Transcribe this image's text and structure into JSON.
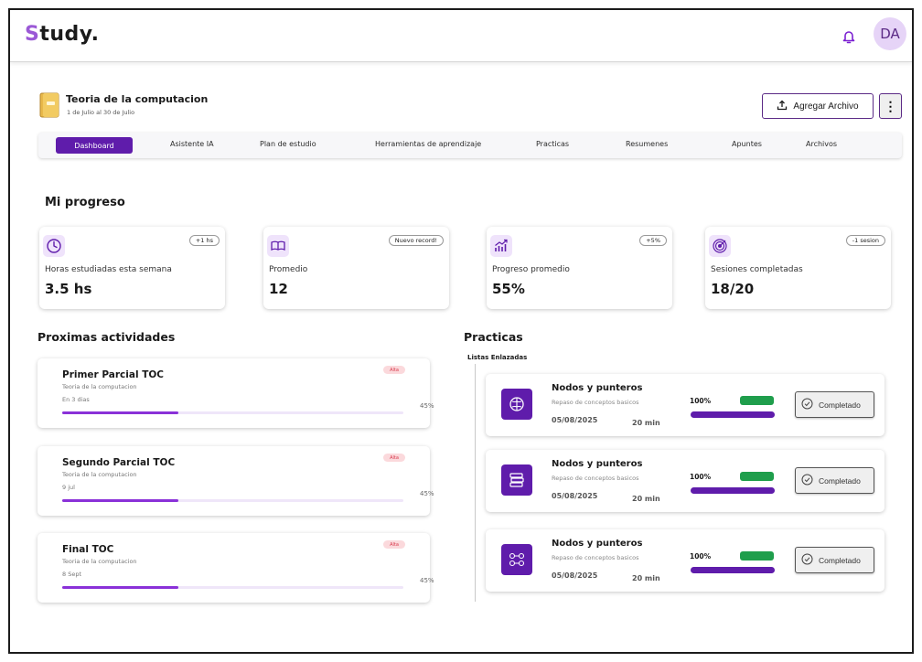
{
  "header": {
    "logo_first": "S",
    "logo_rest": "tudy.",
    "avatar_initials": "DA",
    "icons": {
      "notifications": "bell-icon"
    }
  },
  "course": {
    "title": "Teoria de la computacion",
    "dates": "1 de Julio al 30 de Julio",
    "add_file_label": "Agregar Archivo",
    "more_label": "⋮",
    "icons": {
      "course": "folder-icon",
      "add_file": "upload-icon"
    }
  },
  "nav": {
    "items": [
      {
        "label": "Dashboard",
        "active": true
      },
      {
        "label": "Asistente IA"
      },
      {
        "label": "Plan de estudio"
      },
      {
        "label": "Herramientas de aprendizaje"
      },
      {
        "label": "Practicas"
      },
      {
        "label": "Resumenes"
      },
      {
        "label": "Apuntes"
      },
      {
        "label": "Archivos"
      }
    ]
  },
  "progress": {
    "title": "Mi progreso",
    "stats": [
      {
        "icon": "clock-icon",
        "badge": "+1 hs",
        "label": "Horas estudiadas esta semana",
        "value": "3.5 hs"
      },
      {
        "icon": "book-icon",
        "badge": "Nuevo record!",
        "label": "Promedio",
        "value": "12"
      },
      {
        "icon": "chart-up-icon",
        "badge": "+5%",
        "label": "Progreso promedio",
        "value": "55%"
      },
      {
        "icon": "target-icon",
        "badge": "-1 sesion",
        "label": "Sesiones completadas",
        "value": "18/20"
      }
    ]
  },
  "activities": {
    "title": "Proximas actividades",
    "items": [
      {
        "title": "Primer Parcial TOC",
        "course": "Teoria de la computacion",
        "when": "En 3 dias",
        "priority": "Alta",
        "percent_label": "45%",
        "progress": 0.34
      },
      {
        "title": "Segundo Parcial TOC",
        "course": "Teoria de la computacion",
        "when": "9 jul",
        "priority": "Alta",
        "percent_label": "45%",
        "progress": 0.34
      },
      {
        "title": "Final TOC",
        "course": "Teoria de la computacion",
        "when": "8 Sept",
        "priority": "Alta",
        "percent_label": "45%",
        "progress": 0.34
      }
    ]
  },
  "practicas": {
    "title": "Practicas",
    "subtitle": "Listas Enlazadas",
    "items": [
      {
        "icon": "brain-icon",
        "title": "Nodos y punteros",
        "subtitle": "Repaso de conceptos basicos",
        "date": "05/08/2025",
        "duration": "20 min",
        "percent": "100%",
        "progress": 1.0,
        "status": "Completado",
        "status_icon": "check-circle-icon"
      },
      {
        "icon": "books-stack-icon",
        "title": "Nodos y punteros",
        "subtitle": "Repaso de conceptos basicos",
        "date": "05/08/2025",
        "duration": "20 min",
        "percent": "100%",
        "progress": 1.0,
        "status": "Completado",
        "status_icon": "check-circle-icon"
      },
      {
        "icon": "flow-icon",
        "title": "Nodos y punteros",
        "subtitle": "Repaso de conceptos basicos",
        "date": "05/08/2025",
        "duration": "20 min",
        "percent": "100%",
        "progress": 1.0,
        "status": "Completado",
        "status_icon": "check-circle-icon"
      }
    ]
  },
  "colors": {
    "primary": "#5f1cab",
    "progress_fill": "#8a31d8",
    "accent_logo": "#9b59d6",
    "success": "#1f9e4c",
    "priority_bg": "#fbd9dc",
    "priority_text": "#d8394c"
  }
}
